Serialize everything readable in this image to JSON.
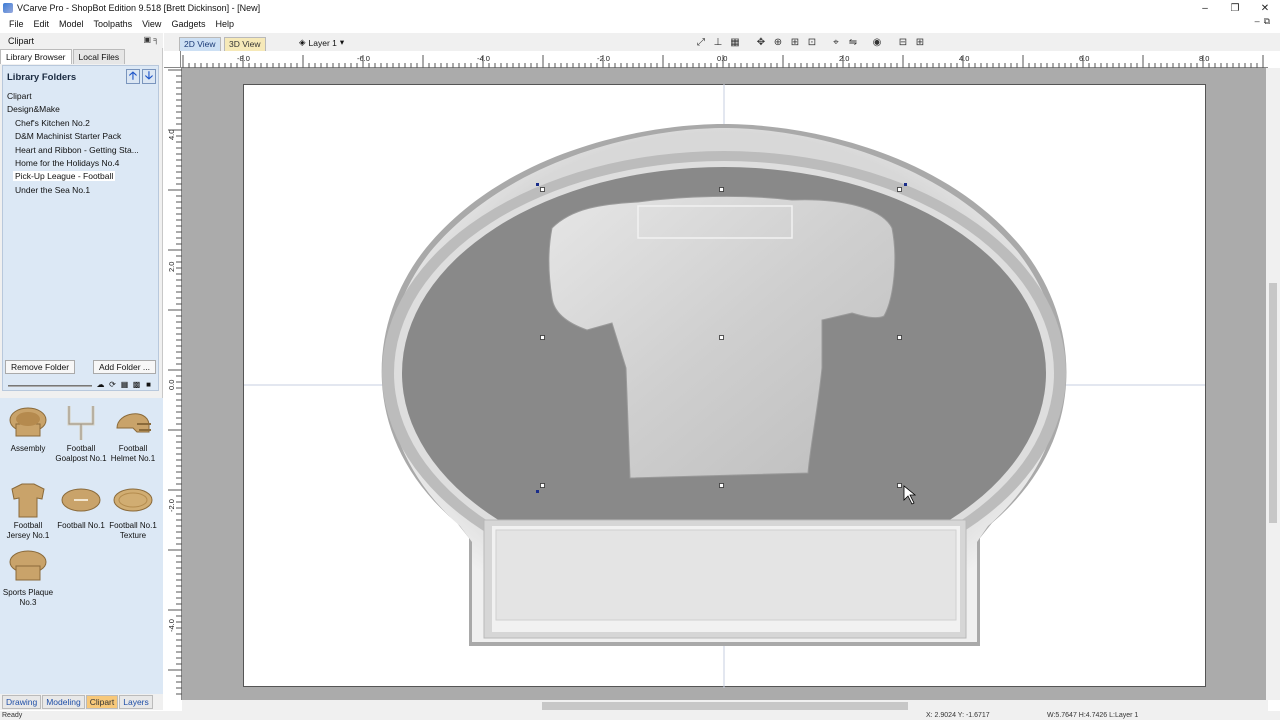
{
  "window": {
    "title": "VCarve Pro - ShopBot Edition 9.518 [Brett Dickinson] - [New]",
    "controls": [
      "–",
      "❐",
      "✕"
    ]
  },
  "menu": [
    "File",
    "Edit",
    "Model",
    "Toolpaths",
    "View",
    "Gadgets",
    "Help"
  ],
  "left_panel": {
    "header": "Clipart",
    "tabs": [
      "Library Browser",
      "Local Files"
    ],
    "library_title": "Library Folders",
    "folders": [
      {
        "label": "Clipart",
        "level": 0
      },
      {
        "label": "Design&Make",
        "level": 0
      },
      {
        "label": "Chef's Kitchen No.2",
        "level": 1
      },
      {
        "label": "D&M Machinist Starter Pack",
        "level": 1
      },
      {
        "label": "Heart and Ribbon - Getting Sta...",
        "level": 1
      },
      {
        "label": "Home for the Holidays No.4",
        "level": 1
      },
      {
        "label": "Pick-Up League - Football",
        "level": 1,
        "selected": true
      },
      {
        "label": "Under the Sea No.1",
        "level": 1
      }
    ],
    "remove_folder": "Remove Folder",
    "add_folder": "Add Folder ...",
    "thumbnails": [
      {
        "label": "Assembly",
        "icon": "plaque-icon"
      },
      {
        "label": "Football Goalpost No.1",
        "icon": "goalpost-icon"
      },
      {
        "label": "Football Helmet No.1",
        "icon": "helmet-icon"
      },
      {
        "label": "Football Jersey No.1",
        "icon": "jersey-icon"
      },
      {
        "label": "Football No.1",
        "icon": "football-icon"
      },
      {
        "label": "Football No.1 Texture",
        "icon": "football-texture-icon"
      },
      {
        "label": "Sports Plaque No.3",
        "icon": "plaque-icon"
      }
    ],
    "bottom_tabs": [
      "Drawing",
      "Modeling",
      "Clipart",
      "Layers"
    ],
    "active_bottom_tab": "Clipart"
  },
  "view": {
    "tab_2d": "2D View",
    "tab_3d": "3D View",
    "layer": "Layer 1",
    "ruler_h_labels": [
      "-8.0",
      "-6.0",
      "-4.0",
      "-2.0",
      "0.0",
      "2.0",
      "4.0",
      "6.0",
      "8.0"
    ],
    "ruler_v_labels": [
      "4.0",
      "2.0",
      "0.0",
      "-2.0",
      "-4.0"
    ]
  },
  "status": {
    "left": "Ready",
    "coords": "X: 2.9024 Y: -1.6717",
    "dims": "W:5.7647  H:4.7426  L:Layer 1"
  },
  "colors": {
    "panel_blue": "#dce8f5",
    "active_tab": "#f7c87a",
    "canvas_bg": "#ababab",
    "plaque_gray": "#8a8a8a"
  }
}
